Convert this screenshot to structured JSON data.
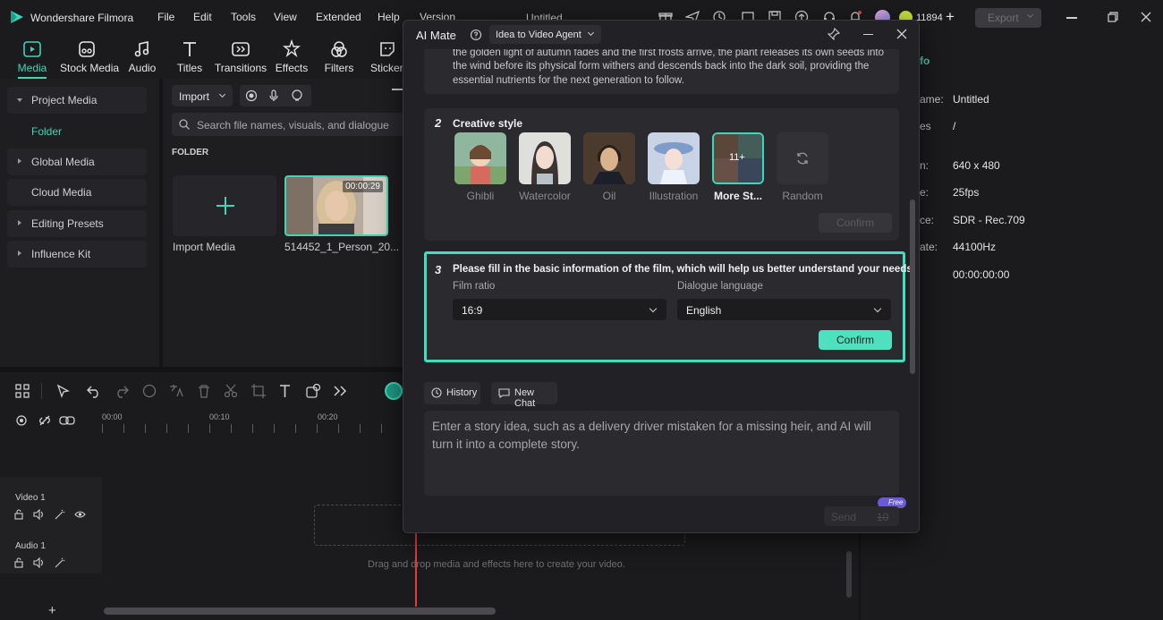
{
  "app": {
    "title": "Wondershare Filmora",
    "menu": [
      "File",
      "Edit",
      "Tools",
      "View",
      "Extended",
      "Help",
      "Version"
    ],
    "project_title": "Untitled",
    "credits": "11894",
    "export_label": "Export"
  },
  "toolbar": [
    {
      "label": "Media",
      "icon": "media-icon",
      "active": true
    },
    {
      "label": "Stock Media",
      "icon": "stock-media-icon"
    },
    {
      "label": "Audio",
      "icon": "audio-icon"
    },
    {
      "label": "Titles",
      "icon": "titles-icon"
    },
    {
      "label": "Transitions",
      "icon": "transitions-icon"
    },
    {
      "label": "Effects",
      "icon": "effects-icon"
    },
    {
      "label": "Filters",
      "icon": "filters-icon"
    },
    {
      "label": "Stickers",
      "icon": "stickers-icon"
    }
  ],
  "sidebar": {
    "items": [
      {
        "label": "Project Media",
        "expanded": true
      },
      {
        "label": "Folder"
      },
      {
        "label": "Global Media"
      },
      {
        "label": "Cloud Media"
      },
      {
        "label": "Editing Presets"
      },
      {
        "label": "Influence Kit"
      }
    ]
  },
  "media": {
    "import_label": "Import",
    "search_placeholder": "Search file names, visuals, and dialogue",
    "folder_heading": "FOLDER",
    "import_media_label": "Import Media",
    "clip_name": "514452_1_Person_20...",
    "clip_duration": "00:00:29"
  },
  "dialog": {
    "title": "AI Mate",
    "mode": "Idea to Video Agent",
    "story_text": "the golden light of autumn fades and the first frosts arrive, the plant releases its own seeds into the wind before its physical form withers and descends back into the dark soil, providing the essential nutrients for the next generation to follow.",
    "step2": {
      "number": "2",
      "title": "Creative style",
      "styles": [
        {
          "label": "Ghibli"
        },
        {
          "label": "Watercolor"
        },
        {
          "label": "Oil"
        },
        {
          "label": "Illustration"
        },
        {
          "label": "More St...",
          "badge": "11+"
        },
        {
          "label": "Random"
        }
      ],
      "confirm_label": "Confirm"
    },
    "step3": {
      "number": "3",
      "title": "Please fill in the basic information of the film, which will help us better understand your needs.",
      "ratio_label": "Film ratio",
      "ratio_value": "16:9",
      "language_label": "Dialogue language",
      "language_value": "English",
      "confirm_label": "Confirm"
    },
    "history_label": "History",
    "new_chat_label": "New Chat",
    "input_placeholder": "Enter a story idea, such as a delivery driver mistaken for a missing heir, and AI will turn it into a complete story.",
    "send_label": "Send",
    "send_cost": "10",
    "free_badge": "Free"
  },
  "timeline": {
    "ticks": [
      "00:00",
      "00:10",
      "00:20"
    ],
    "video_track": "Video 1",
    "audio_track": "Audio 1",
    "drop_hint": "Drag and drop media and effects here to create your video."
  },
  "properties": {
    "tab_label": "fo",
    "rows": [
      {
        "label": "ame:",
        "value": "Untitled"
      },
      {
        "label": "es",
        "value": "/"
      },
      {
        "label": "n:",
        "value": "640 x 480"
      },
      {
        "label": "e:",
        "value": "25fps"
      },
      {
        "label": "ce:",
        "value": "SDR - Rec.709"
      },
      {
        "label": "ate:",
        "value": "44100Hz"
      },
      {
        "label": "",
        "value": "00:00:00:00"
      }
    ]
  },
  "colors": {
    "accent": "#3fd5b8",
    "confirm_active": "#4fe0c0",
    "highlight_border": "#3fe0c0",
    "playhead": "#e23c3c"
  }
}
